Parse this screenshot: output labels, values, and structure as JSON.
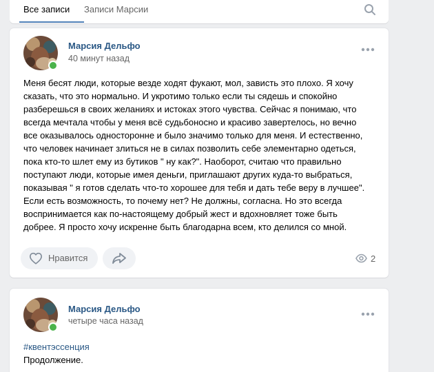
{
  "tabs": {
    "all_posts": "Все записи",
    "user_posts": "Записи Марсии"
  },
  "posts": [
    {
      "author": "Марсия Дельфо",
      "time": "40 минут назад",
      "text": "Меня бесят люди, которые везде ходят фукают, мол, зависть это плохо. Я хочу\nсказать, что это нормально. И укротимо только если ты сядешь и спокойно\nразберешься в своих желаниях и истоках этого чувства. Сейчас я понимаю, что\nвсегда мечтала чтобы у меня всё судьбоносно и красиво завертелось, но вечно\nвсе оказывалось односторонне и было значимо только для меня. И естественно,\nчто человек начинает злиться не в силах позволить себе элементарно одеться,\nпока кто-то шлет ему из бутиков \" ну как?\". Наоборот, считаю что правильно\nпоступают люди, которые имея деньги, приглашают других куда-то выбраться,\nпоказывая \" я готов сделать что-то хорошее для тебя и дать тебе веру в лучшее\".\nЕсли есть возможность, то почему нет? Не должны, согласна. Но это всегда\nвоспринимается как по-настоящему добрый жест и вдохновляет тоже быть\nдобрее. Я просто хочу искренне быть благодарна всем, кто делился со мной.",
      "like_label": "Нравится",
      "views": "2"
    },
    {
      "author": "Марсия Дельфо",
      "time": "четыре часа назад",
      "hashtag": "#квентэссенция",
      "text": "Продолжение."
    }
  ],
  "colors": {
    "link": "#2a5885",
    "online": "#4bb34b",
    "page_bg": "#edeef0"
  },
  "icons": [
    "search-icon",
    "more-icon",
    "heart-icon",
    "share-icon",
    "eye-icon"
  ]
}
